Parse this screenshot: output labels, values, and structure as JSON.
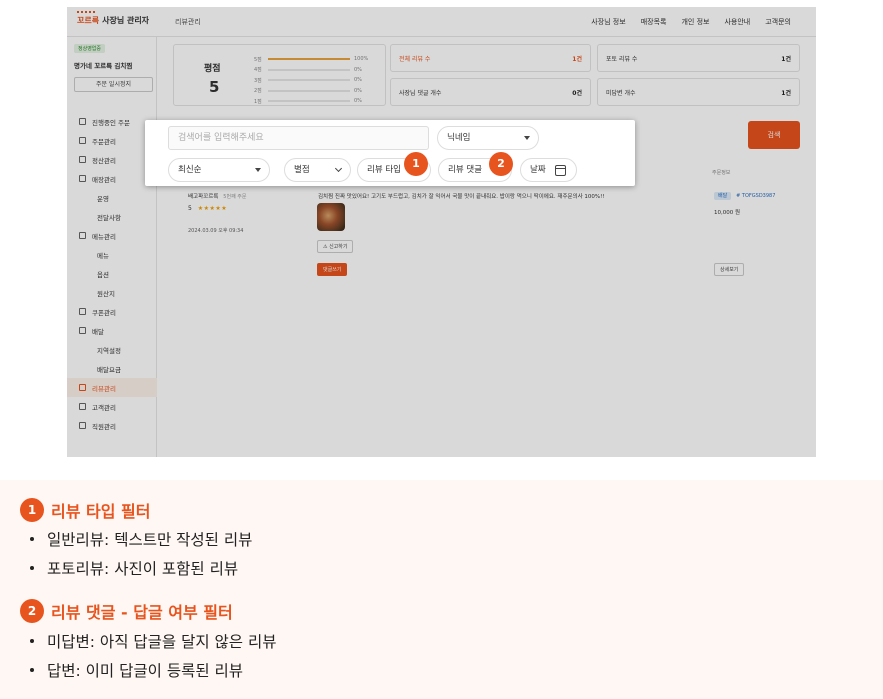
{
  "header": {
    "logo_brand": "꼬르륵",
    "logo_text": "사장님 관리자",
    "breadcrumb": "리뷰관리",
    "nav": [
      "사장님 정보",
      "매장목록",
      "개인 정보",
      "사용안내",
      "고객문의"
    ]
  },
  "sidebar": {
    "status_badge": "정상영업중",
    "store_name": "명가네 꼬르륵 김치찜",
    "pause_button": "주문 일시정지",
    "items": [
      {
        "label": "진행중인 주문",
        "icon": "clipboard-icon"
      },
      {
        "label": "주문관리",
        "icon": "receipt-icon"
      },
      {
        "label": "정산관리",
        "icon": "calculator-icon"
      },
      {
        "label": "매장관리",
        "icon": "store-icon"
      },
      {
        "label": "운영",
        "sub": true
      },
      {
        "label": "전달사항",
        "sub": true
      },
      {
        "label": "메뉴관리",
        "icon": "menu-book-icon"
      },
      {
        "label": "메뉴",
        "sub": true
      },
      {
        "label": "옵션",
        "sub": true
      },
      {
        "label": "원산지",
        "sub": true
      },
      {
        "label": "쿠폰관리",
        "icon": "coupon-icon"
      },
      {
        "label": "배달",
        "icon": "scooter-icon"
      },
      {
        "label": "지역설정",
        "sub": true
      },
      {
        "label": "배달요금",
        "sub": true
      },
      {
        "label": "리뷰관리",
        "icon": "review-icon",
        "active": true
      },
      {
        "label": "고객관리",
        "icon": "users-icon"
      },
      {
        "label": "직원관리",
        "icon": "staff-icon"
      }
    ]
  },
  "rating": {
    "title": "평점",
    "value": "5",
    "rows": [
      {
        "label": "5점",
        "pct": "100%",
        "fill": 1.0
      },
      {
        "label": "4점",
        "pct": "0%",
        "fill": 0
      },
      {
        "label": "3점",
        "pct": "0%",
        "fill": 0
      },
      {
        "label": "2점",
        "pct": "0%",
        "fill": 0
      },
      {
        "label": "1점",
        "pct": "0%",
        "fill": 0
      }
    ]
  },
  "stats": {
    "total_label": "전체 리뷰 수",
    "total_value": "1건",
    "photo_label": "포토 리뷰 수",
    "photo_value": "1건",
    "reply_label": "사장님 댓글 개수",
    "reply_value": "0건",
    "unanswered_label": "미답변 개수",
    "unanswered_value": "1건"
  },
  "search_button": "검색",
  "table": {
    "order_header": "주문정보"
  },
  "review": {
    "store": "배고파꼬르륵",
    "order_count": "5번째 주문",
    "score": "5",
    "stars": "★★★★★",
    "date": "2024.03.09 오후 09:34",
    "text": "김치찜 진짜 맛있어요! 고기도 부드럽고, 김치가 잘 익어서 국물 맛이 끝내줘요. 밥이랑 먹으니 딱이에요. 재주문의사 100%!!",
    "report": "신고하기",
    "reply_button": "댓글쓰기",
    "delivery_tag": "배달",
    "order_id": "# TOFGSD3987",
    "price": "10,000 원",
    "detail_button": "상세보기"
  },
  "filter": {
    "search_placeholder": "검색어를 입력해주세요",
    "nickname_select": "닉네임",
    "sort_select": "최신순",
    "rating_select": "별점",
    "review_type": "리뷰 타입",
    "review_reply": "리뷰 댓글",
    "date": "날짜",
    "marker1": "1",
    "marker2": "2"
  },
  "legend": {
    "s1_num": "1",
    "s1_title": "리뷰 타입 필터",
    "s1_items": [
      "일반리뷰: 텍스트만 작성된 리뷰",
      "포토리뷰: 사진이 포함된 리뷰"
    ],
    "s2_num": "2",
    "s2_title": "리뷰 댓글 - 답글 여부 필터",
    "s2_items": [
      "미답변: 아직 답글을 달지 않은 리뷰",
      "답변: 이미 답글이 등록된 리뷰"
    ]
  },
  "colors": {
    "accent": "#e8541e",
    "star": "#f0a000",
    "badge": "#2e8b2e"
  }
}
